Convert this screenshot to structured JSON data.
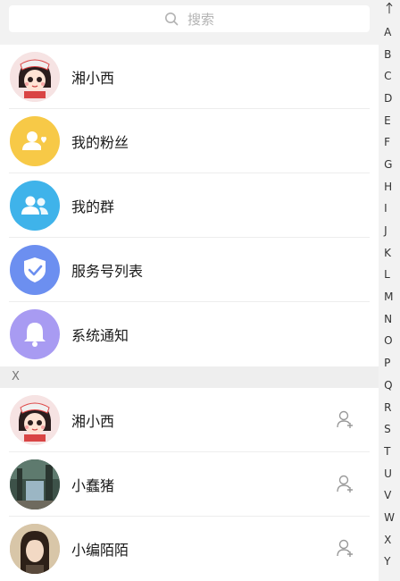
{
  "search": {
    "placeholder": "搜索"
  },
  "top_items": [
    {
      "label": "湘小西",
      "icon": "girl-avatar",
      "color": "#f4d7d7"
    },
    {
      "label": "我的粉丝",
      "icon": "fans-icon",
      "color": "#f7c947"
    },
    {
      "label": "我的群",
      "icon": "group-icon",
      "color": "#3fb3ea"
    },
    {
      "label": "服务号列表",
      "icon": "shield-check-icon",
      "color": "#6c8ff0"
    },
    {
      "label": "系统通知",
      "icon": "bell-icon",
      "color": "#a89bf2"
    }
  ],
  "section": {
    "letter": "X"
  },
  "contacts": [
    {
      "name": "湘小西",
      "icon": "girl-avatar"
    },
    {
      "name": "小蠢猪",
      "icon": "photo-avatar"
    },
    {
      "name": "小编陌陌",
      "icon": "portrait-avatar"
    }
  ],
  "index_letters": [
    "A",
    "B",
    "C",
    "D",
    "E",
    "F",
    "G",
    "H",
    "I",
    "J",
    "K",
    "L",
    "M",
    "N",
    "O",
    "P",
    "Q",
    "R",
    "S",
    "T",
    "U",
    "V",
    "W",
    "X",
    "Y"
  ]
}
